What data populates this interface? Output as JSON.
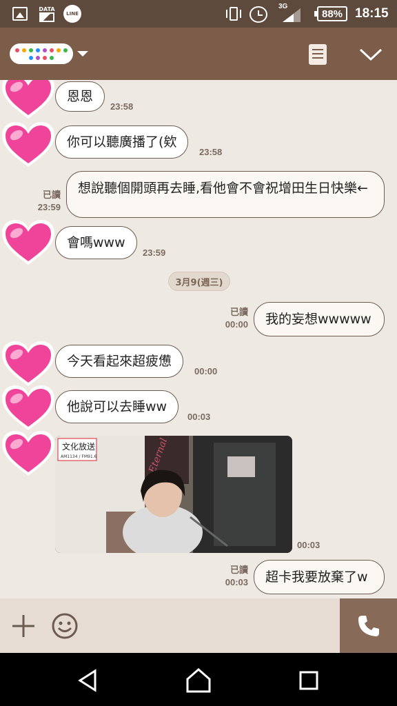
{
  "status_bar": {
    "data_label": "DATA",
    "line_label": "LINE",
    "network": "3G",
    "battery": "88%",
    "time": "18:15"
  },
  "header": {
    "chat_name_dot_colors": [
      "#e94f64",
      "#f6a800",
      "#3cb54a",
      "#1e90ff",
      "#b14fc5",
      "#e94f64",
      "#f6a800",
      "#3cb54a",
      "#1e90ff",
      "#b14fc5",
      "#e94f64",
      "#3cb54a"
    ],
    "icons": {
      "note": "note-icon",
      "collapse": "chevron-down-icon"
    }
  },
  "messages": [
    {
      "side": "in",
      "text": "恩恩",
      "time": "23:58"
    },
    {
      "side": "in",
      "text": "你可以聽廣播了(欸",
      "time": "23:58"
    },
    {
      "side": "out",
      "text": "想說聽個開頭再去睡,看他會不會祝增田生日快樂←",
      "read": "已讀",
      "time": "23:59"
    },
    {
      "side": "in",
      "text": "會嗎www",
      "time": "23:59"
    },
    {
      "side": "out",
      "text": "我的妄想wwwww",
      "read": "已讀",
      "time": "00:00"
    },
    {
      "side": "in",
      "text": "今天看起來超疲憊",
      "time": "00:00"
    },
    {
      "side": "in",
      "text": "他說可以去睡ww",
      "time": "00:03"
    },
    {
      "side": "in",
      "type": "photo",
      "time": "00:03",
      "photo_sign": "文化放送",
      "photo_sign_sub": "AM1134 / FM91.6",
      "photo_poster": "Eternal"
    },
    {
      "side": "out",
      "text": "超卡我要放棄了w",
      "read": "已讀",
      "time": "00:03"
    }
  ],
  "date_divider": "3月9(週三)",
  "input_bar": {
    "icons": {
      "add": "plus-icon",
      "sticker": "smiley-icon",
      "call": "phone-icon"
    }
  },
  "nav_bar": {
    "icons": {
      "back": "back-triangle-icon",
      "home": "home-icon",
      "recents": "recents-square-icon"
    }
  },
  "colors": {
    "status_bar": "#5d4a3c",
    "header": "#7b5d49",
    "chat_background": "#efe9e3",
    "avatar_heart": "#f0449a",
    "call_button": "#876a57"
  }
}
